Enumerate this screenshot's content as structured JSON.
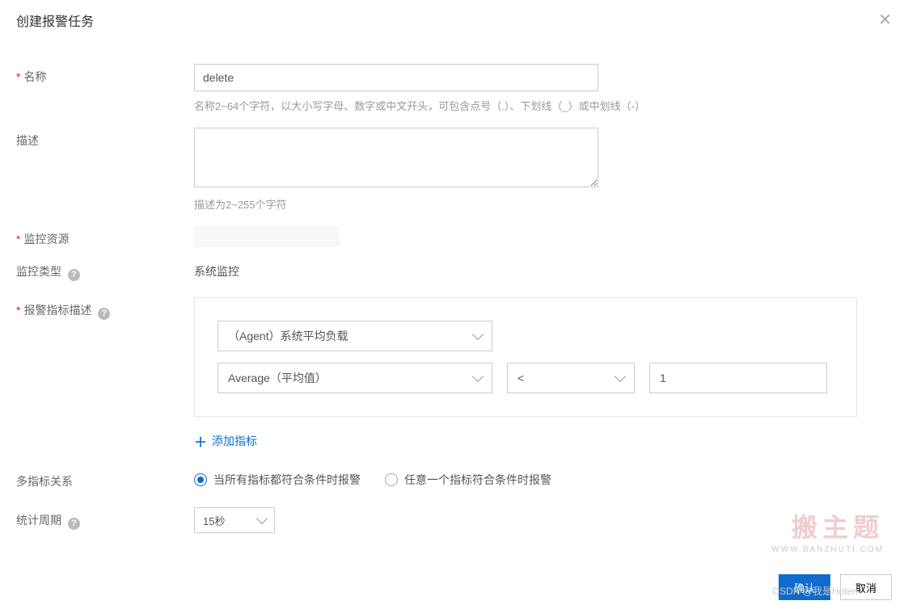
{
  "header": {
    "title": "创建报警任务"
  },
  "form": {
    "name": {
      "label": "名称",
      "value": "delete",
      "hint": "名称2~64个字符，以大小写字母、数字或中文开头，可包含点号（.）、下划线（_）或中划线（-）"
    },
    "description": {
      "label": "描述",
      "value": "",
      "hint": "描述为2~255个字符"
    },
    "monitor_resource": {
      "label": "监控资源"
    },
    "monitor_type": {
      "label": "监控类型",
      "value": "系统监控"
    },
    "metric_desc": {
      "label": "报警指标描述",
      "metric_select": "（Agent）系统平均负载",
      "agg_select": "Average（平均值）",
      "op_select": "<",
      "threshold": "1",
      "add_label": "添加指标"
    },
    "multi_relation": {
      "label": "多指标关系",
      "opt_all": "当所有指标都符合条件时报警",
      "opt_any": "任意一个指标符合条件时报警",
      "selected": "all"
    },
    "stat_period": {
      "label": "统计周期",
      "value": "15秒"
    }
  },
  "footer": {
    "confirm": "确认",
    "cancel": "取消"
  },
  "watermark": {
    "text": "搬主题",
    "sub": "WWW.BANZHUTI.COM"
  },
  "attribution": "CSDN @我是Hoten"
}
